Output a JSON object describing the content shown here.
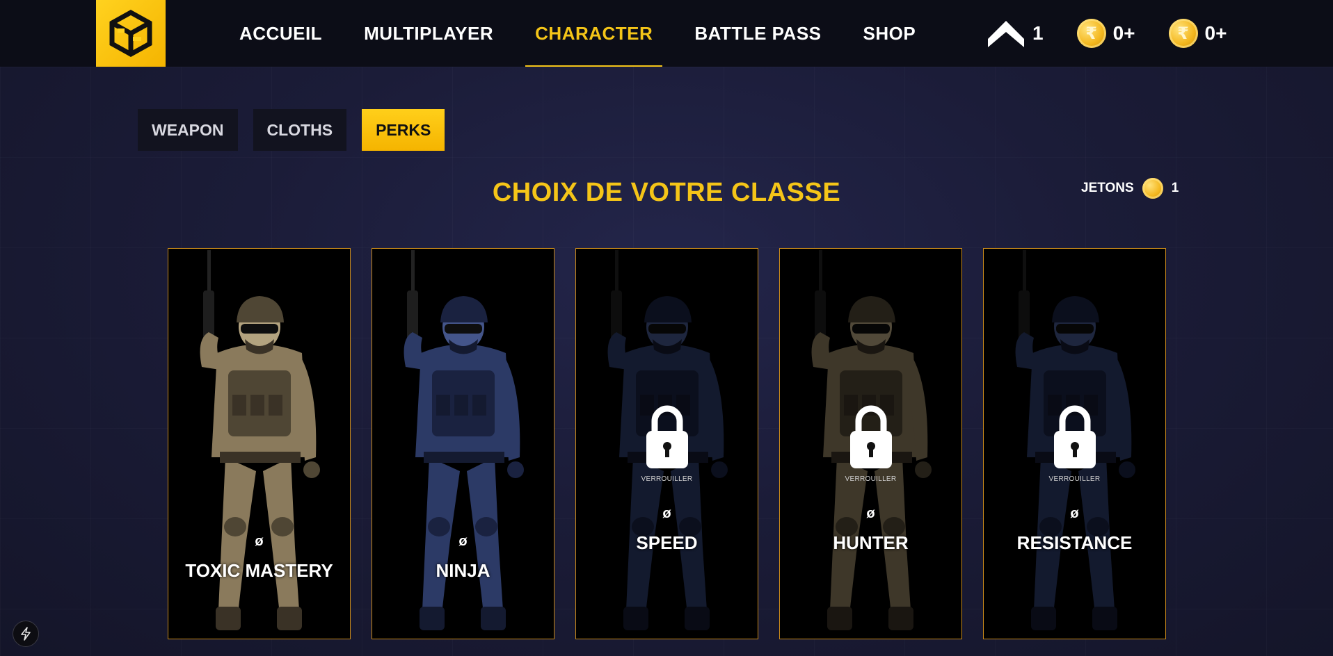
{
  "brand": {
    "logo_icon": "cube-logo-icon",
    "accent_color": "#f5c518"
  },
  "nav": {
    "links": [
      {
        "label": "ACCUEIL",
        "active": false
      },
      {
        "label": "MULTIPLAYER",
        "active": false
      },
      {
        "label": "CHARACTER",
        "active": true
      },
      {
        "label": "BATTLE PASS",
        "active": false
      },
      {
        "label": "SHOP",
        "active": false
      }
    ],
    "rank": {
      "icon": "chevron-rank-icon",
      "value": "1"
    },
    "currency_1": {
      "icon": "rupee-coin-icon",
      "symbol": "₹",
      "value": "0+"
    },
    "currency_2": {
      "icon": "rupee-coin-icon",
      "symbol": "₹",
      "value": "0+"
    }
  },
  "tabs": [
    {
      "label": "WEAPON",
      "active": false
    },
    {
      "label": "CLOTHS",
      "active": false
    },
    {
      "label": "PERKS",
      "active": true
    }
  ],
  "section": {
    "title": "CHOIX DE VOTRE CLASSE"
  },
  "tokens": {
    "label": "JETONS",
    "value": "1",
    "icon": "coin-icon"
  },
  "perks": [
    {
      "name": "TOXIC MASTERY",
      "symbol": "ø",
      "locked": false,
      "palette": "desert"
    },
    {
      "name": "NINJA",
      "symbol": "ø",
      "locked": false,
      "palette": "navy"
    },
    {
      "name": "SPEED",
      "symbol": "ø",
      "locked": true,
      "lock_label": "VERROUILLER",
      "palette": "navy"
    },
    {
      "name": "HUNTER",
      "symbol": "ø",
      "locked": true,
      "lock_label": "VERROUILLER",
      "palette": "desert"
    },
    {
      "name": "RESISTANCE",
      "symbol": "ø",
      "locked": true,
      "lock_label": "VERROUILLER",
      "palette": "navy"
    }
  ],
  "footer": {
    "bolt_icon": "lightning-bolt-icon"
  }
}
